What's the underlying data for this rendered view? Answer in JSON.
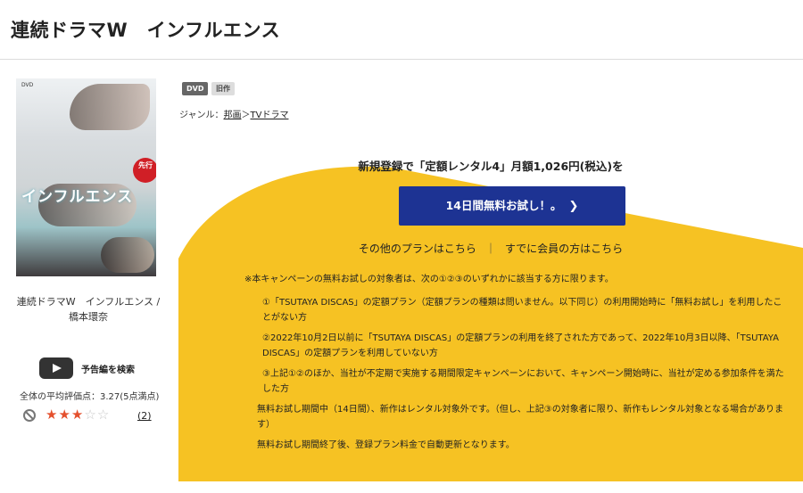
{
  "page": {
    "title": "連続ドラマW　インフルエンス"
  },
  "cover": {
    "label": "DVD",
    "title_text": "インフルエンス",
    "badge_text": "先行"
  },
  "sidebar": {
    "product_name": "連続ドラマW　インフルエンス / 橋本環奈",
    "trailer_label": "予告編を検索",
    "average_rating_label": "全体の平均評価点：",
    "average_rating_value": "3.27(5点満点)",
    "rating": 3.27,
    "review_count": "(2)"
  },
  "tags": [
    "DVD",
    "旧作"
  ],
  "genre": {
    "label": "ジャンル：",
    "items": [
      "邦画",
      "TVドラマ"
    ],
    "separator": "＞"
  },
  "promo": {
    "lead": "新規登録で「定額レンタル4」月額1,026円(税込)を",
    "cta_label": "14日間無料お試し！。",
    "cta_icon": "chevron-right-icon",
    "other_plans": "その他のプランはこちら",
    "link_separator": "｜",
    "members_link": "すでに会員の方はこちら",
    "bg_color": "#f6c223",
    "cta_color": "#1d3393"
  },
  "notes": {
    "lead": "※本キャンペーンの無料お試しの対象者は、次の①②③のいずれかに該当する方に限ります。",
    "conditions": [
      "①「TSUTAYA DISCAS」の定額プラン（定額プランの種類は問いません。以下同じ）の利用開始時に「無料お試し」を利用したことがない方",
      "②2022年10月2日以前に「TSUTAYA DISCAS」の定額プランの利用を終了された方であって、2022年10月3日以降、「TSUTAYA DISCAS」の定額プランを利用していない方",
      "③上記①②のほか、当社が不定期で実施する期間限定キャンペーンにおいて、キャンペーン開始時に、当社が定める参加条件を満たした方"
    ],
    "extra": [
      "無料お試し期間中（14日間）、新作はレンタル対象外です。（但し、上記③の対象者に限り、新作もレンタル対象となる場合があります）",
      "無料お試し期間終了後、登録プラン料金で自動更新となります。"
    ]
  }
}
